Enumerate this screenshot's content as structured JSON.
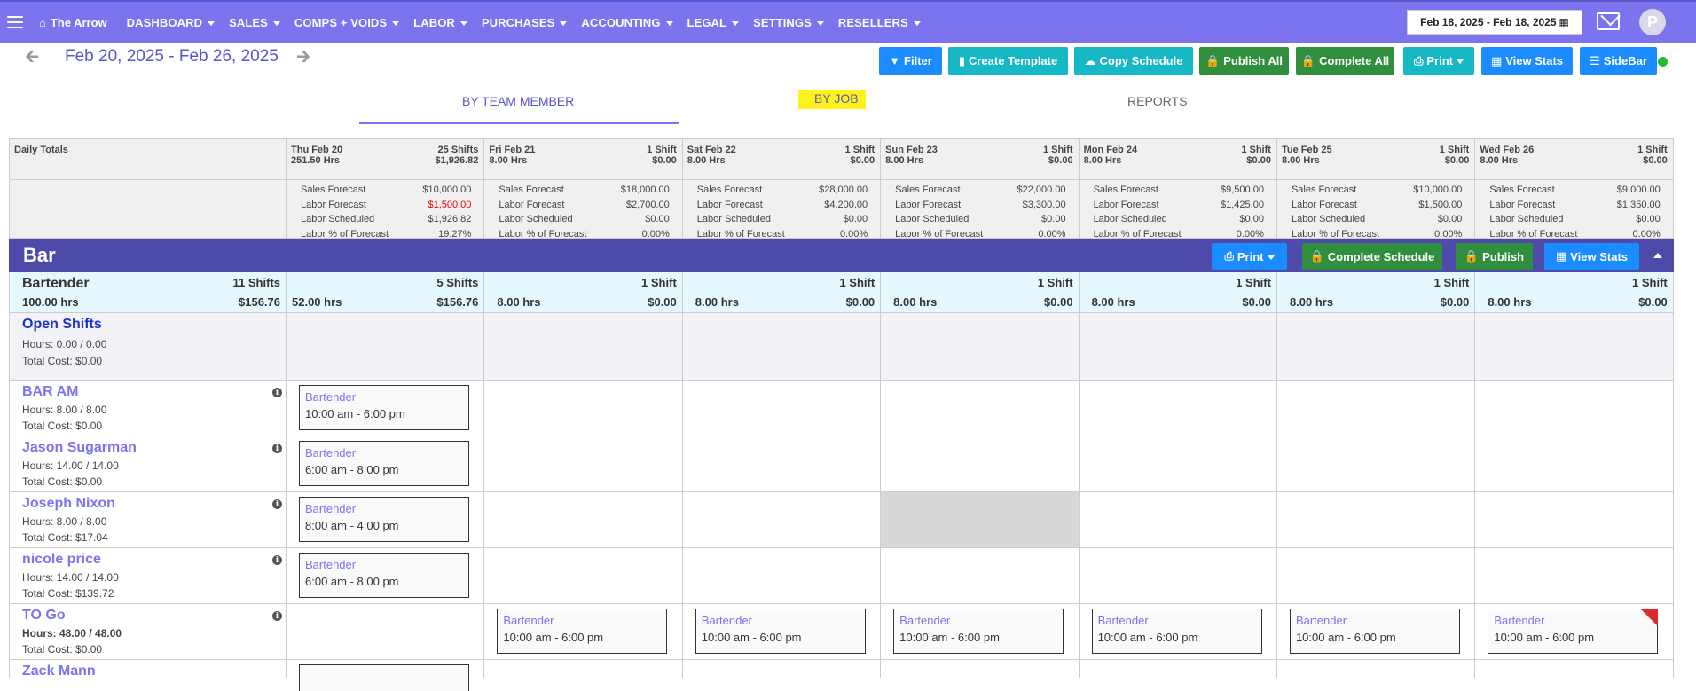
{
  "nav": {
    "brand": "The Arrow",
    "items": [
      "DASHBOARD",
      "SALES",
      "COMPS + VOIDS",
      "LABOR",
      "PURCHASES",
      "ACCOUNTING",
      "LEGAL",
      "SETTINGS",
      "RESELLERS"
    ],
    "date_range": "Feb 18, 2025 - Feb 18, 2025",
    "avatar_letter": "P"
  },
  "week": {
    "title": "Feb 20, 2025 - Feb 26, 2025"
  },
  "toolbar": {
    "filter": "Filter",
    "create_template": "Create Template",
    "copy_schedule": "Copy Schedule",
    "publish_all": "Publish All",
    "complete_all": "Complete All",
    "print": "Print",
    "view_stats": "View Stats",
    "sidebar": "SideBar"
  },
  "tabs": {
    "by_team_member": "BY TEAM MEMBER",
    "by_job": "BY JOB",
    "reports": "REPORTS"
  },
  "daily_totals_label": "Daily Totals",
  "days": [
    {
      "label": "Thu Feb 20",
      "shifts": "25 Shifts",
      "hrs": "251.50 Hrs",
      "cost": "$1,926.82",
      "sales_forecast": "$10,000.00",
      "labor_forecast": "$1,500.00",
      "labor_scheduled": "$1,926.82",
      "labor_pct": "19.27%"
    },
    {
      "label": "Fri Feb 21",
      "shifts": "1 Shift",
      "hrs": "8.00 Hrs",
      "cost": "$0.00",
      "sales_forecast": "$18,000.00",
      "labor_forecast": "$2,700.00",
      "labor_scheduled": "$0.00",
      "labor_pct": "0.00%"
    },
    {
      "label": "Sat Feb 22",
      "shifts": "1 Shift",
      "hrs": "8.00 Hrs",
      "cost": "$0.00",
      "sales_forecast": "$28,000.00",
      "labor_forecast": "$4,200.00",
      "labor_scheduled": "$0.00",
      "labor_pct": "0.00%"
    },
    {
      "label": "Sun Feb 23",
      "shifts": "1 Shift",
      "hrs": "8.00 Hrs",
      "cost": "$0.00",
      "sales_forecast": "$22,000.00",
      "labor_forecast": "$3,300.00",
      "labor_scheduled": "$0.00",
      "labor_pct": "0.00%"
    },
    {
      "label": "Mon Feb 24",
      "shifts": "1 Shift",
      "hrs": "8.00 Hrs",
      "cost": "$0.00",
      "sales_forecast": "$9,500.00",
      "labor_forecast": "$1,425.00",
      "labor_scheduled": "$0.00",
      "labor_pct": "0.00%"
    },
    {
      "label": "Tue Feb 25",
      "shifts": "1 Shift",
      "hrs": "8.00 Hrs",
      "cost": "$0.00",
      "sales_forecast": "$10,000.00",
      "labor_forecast": "$1,500.00",
      "labor_scheduled": "$0.00",
      "labor_pct": "0.00%"
    },
    {
      "label": "Wed Feb 26",
      "shifts": "1 Shift",
      "hrs": "8.00 Hrs",
      "cost": "$0.00",
      "sales_forecast": "$9,000.00",
      "labor_forecast": "$1,350.00",
      "labor_scheduled": "$0.00",
      "labor_pct": "0.00%"
    }
  ],
  "forecast_labels": {
    "sales": "Sales Forecast",
    "labor": "Labor Forecast",
    "scheduled": "Labor Scheduled",
    "pct": "Labor % of Forecast"
  },
  "section": {
    "title": "Bar",
    "print": "Print",
    "complete_schedule": "Complete Schedule",
    "publish": "Publish",
    "view_stats": "View Stats"
  },
  "role": {
    "name": "Bartender",
    "shifts": "11 Shifts",
    "hrs": "100.00 hrs",
    "cost": "$156.76",
    "days": [
      {
        "shifts": "5 Shifts",
        "hrs": "52.00 hrs",
        "cost": "$156.76"
      },
      {
        "shifts": "1 Shift",
        "hrs": "8.00 hrs",
        "cost": "$0.00"
      },
      {
        "shifts": "1 Shift",
        "hrs": "8.00 hrs",
        "cost": "$0.00"
      },
      {
        "shifts": "1 Shift",
        "hrs": "8.00 hrs",
        "cost": "$0.00"
      },
      {
        "shifts": "1 Shift",
        "hrs": "8.00 hrs",
        "cost": "$0.00"
      },
      {
        "shifts": "1 Shift",
        "hrs": "8.00 hrs",
        "cost": "$0.00"
      },
      {
        "shifts": "1 Shift",
        "hrs": "8.00 hrs",
        "cost": "$0.00"
      }
    ]
  },
  "open_shifts": {
    "name": "Open Shifts",
    "hours": "Hours: 0.00 / 0.00",
    "cost": "Total Cost: $0.00"
  },
  "people": [
    {
      "name": "BAR AM",
      "hours": "Hours: 8.00 / 8.00",
      "cost": "Total Cost: $0.00",
      "shift_job": "Bartender",
      "shift_time": "10:00 am - 6:00 pm"
    },
    {
      "name": "Jason Sugarman",
      "hours": "Hours: 14.00 / 14.00",
      "cost": "Total Cost: $0.00",
      "shift_job": "Bartender",
      "shift_time": "6:00 am - 8:00 pm"
    },
    {
      "name": "Joseph Nixon",
      "hours": "Hours: 8.00 / 8.00",
      "cost": "Total Cost: $17.04",
      "shift_job": "Bartender",
      "shift_time": "8:00 am - 4:00 pm"
    },
    {
      "name": "nicole price",
      "hours": "Hours: 14.00 / 14.00",
      "cost": "Total Cost: $139.72",
      "shift_job": "Bartender",
      "shift_time": "6:00 am - 8:00 pm"
    },
    {
      "name": "TO Go",
      "hours": "Hours: 48.00 / 48.00",
      "cost": "Total Cost: $0.00",
      "shift_job": "Bartender",
      "shift_time": "10:00 am - 6:00 pm"
    },
    {
      "name": "Zack Mann"
    }
  ],
  "colors": {
    "nav": "#7b74ee",
    "section": "#4e4aaa",
    "blue_btn": "#1a8cff",
    "teal_btn": "#17b8c5",
    "green_btn": "#2f8f3f"
  }
}
